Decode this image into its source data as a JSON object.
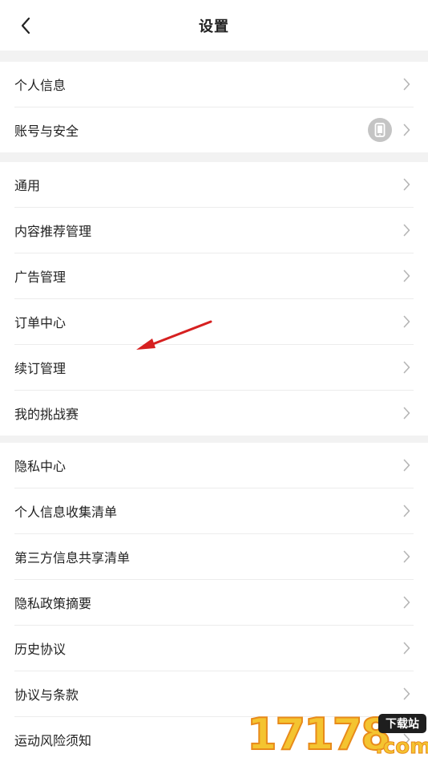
{
  "header": {
    "title": "设置",
    "back_icon": "chevron-left-icon"
  },
  "groups": [
    {
      "items": [
        {
          "label": "个人信息"
        },
        {
          "label": "账号与安全",
          "badge_icon": "phone-icon"
        }
      ]
    },
    {
      "items": [
        {
          "label": "通用"
        },
        {
          "label": "内容推荐管理"
        },
        {
          "label": "广告管理"
        },
        {
          "label": "订单中心"
        },
        {
          "label": "续订管理"
        },
        {
          "label": "我的挑战赛"
        }
      ]
    },
    {
      "items": [
        {
          "label": "隐私中心"
        },
        {
          "label": "个人信息收集清单"
        },
        {
          "label": "第三方信息共享清单"
        },
        {
          "label": "隐私政策摘要"
        },
        {
          "label": "历史协议"
        },
        {
          "label": "协议与条款"
        },
        {
          "label": "运动风险须知"
        }
      ]
    }
  ],
  "annotation": {
    "arrow_color": "#d62020"
  },
  "watermark": {
    "digits": "17178",
    "badge": "下载站",
    "domain": ".com"
  },
  "colors": {
    "background": "#f2f2f2",
    "surface": "#ffffff",
    "divider": "#ececec",
    "chevron": "#b5b5b5",
    "text": "#222222"
  }
}
